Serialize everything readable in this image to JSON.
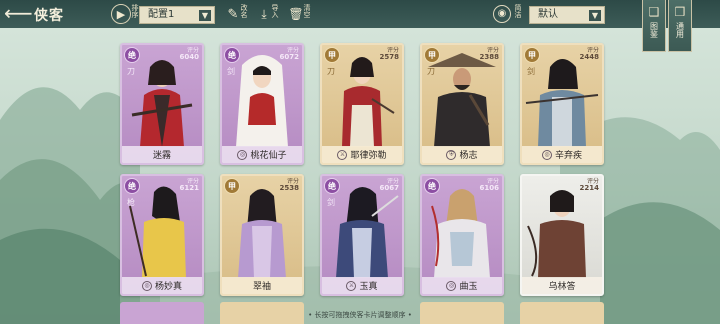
{
  "header": {
    "title": "侠客",
    "rank_btn_label": "排序",
    "config_value": "配置1",
    "edit_label": "改名",
    "import_label": "导入",
    "clear_label": "清空",
    "show_label": "简洁",
    "filter_value": "默认"
  },
  "side_tabs": [
    {
      "label": "图鉴",
      "icon": "book-icon"
    },
    {
      "label": "通用",
      "icon": "scroll-icon"
    }
  ],
  "cards": [
    {
      "name": "迷霧",
      "grade": "绝",
      "rarity": "purple",
      "score_label": "评分",
      "score": "6040",
      "weapon": "刀",
      "sect_icon": ""
    },
    {
      "name": "桃花仙子",
      "grade": "绝",
      "rarity": "purple",
      "score_label": "评分",
      "score": "6072",
      "weapon": "剑",
      "sect_icon": "swirl-icon"
    },
    {
      "name": "耶律弥勒",
      "grade": "甲",
      "rarity": "gold",
      "score_label": "评分",
      "score": "2578",
      "weapon": "刀",
      "sect_icon": "sword-icon"
    },
    {
      "name": "杨志",
      "grade": "甲",
      "rarity": "gold",
      "score_label": "评分",
      "score": "2388",
      "weapon": "刀",
      "sect_icon": "shield-icon"
    },
    {
      "name": "辛弃疾",
      "grade": "甲",
      "rarity": "gold",
      "score_label": "评分",
      "score": "2448",
      "weapon": "剑",
      "sect_icon": "swirl-icon"
    },
    {
      "name": "杨妙真",
      "grade": "绝",
      "rarity": "purple",
      "score_label": "评分",
      "score": "6121",
      "weapon": "枪",
      "sect_icon": "swirl-icon"
    },
    {
      "name": "翠袖",
      "grade": "甲",
      "rarity": "gold",
      "score_label": "评分",
      "score": "2538",
      "weapon": "",
      "sect_icon": ""
    },
    {
      "name": "玉真",
      "grade": "绝",
      "rarity": "purple",
      "score_label": "评分",
      "score": "6067",
      "weapon": "剑",
      "sect_icon": "sword-icon"
    },
    {
      "name": "曲玉",
      "grade": "绝",
      "rarity": "purple",
      "score_label": "评分",
      "score": "6106",
      "weapon": "",
      "sect_icon": "swirl-icon"
    },
    {
      "name": "乌林答",
      "grade": "",
      "rarity": "white",
      "score_label": "评分",
      "score": "2214",
      "weapon": "",
      "sect_icon": ""
    }
  ],
  "hint": "• 长按可拖拽侠客卡片调整顺序 •",
  "colors": {
    "topbar": "#2d4a47",
    "purple_card": "#c9a4d3",
    "gold_card": "#e7d2a6",
    "white_card": "#eeeeea"
  }
}
